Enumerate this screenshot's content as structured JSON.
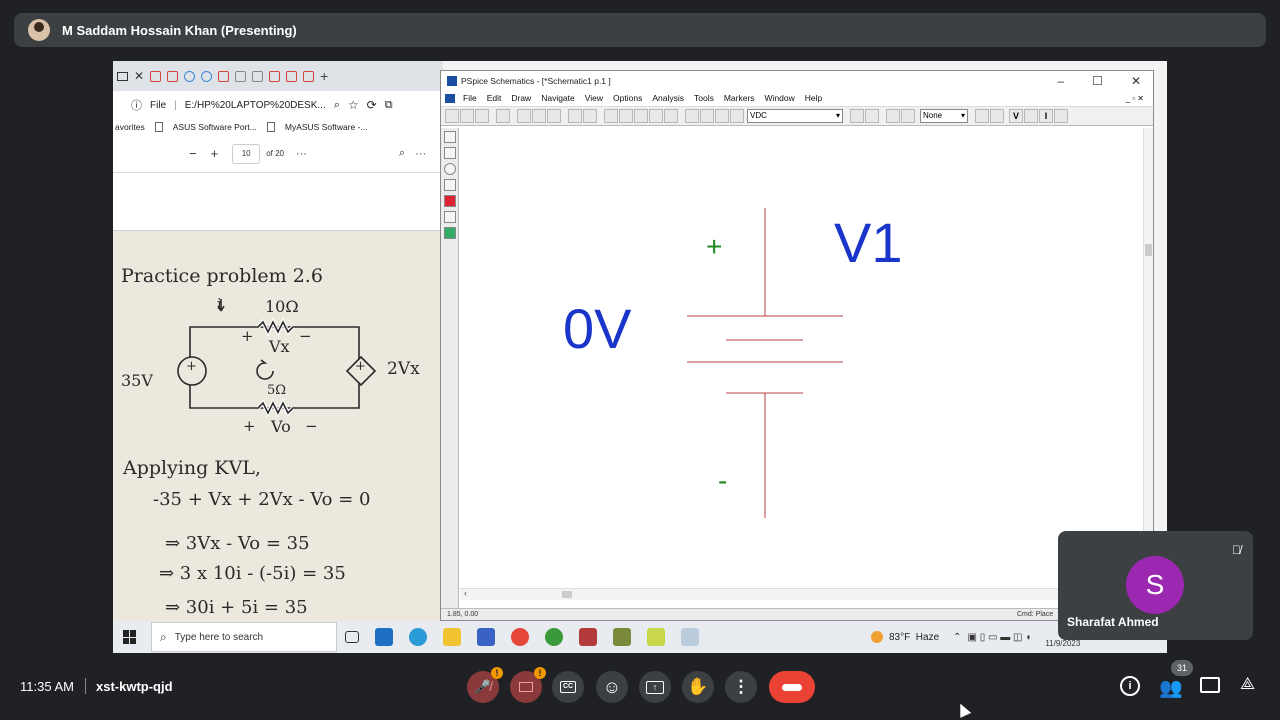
{
  "meet": {
    "presenter_name": "M Saddam Hossain Khan (Presenting)",
    "time": "11:35 AM",
    "meeting_code": "xst-kwtp-qjd",
    "participant_count": "31",
    "tile_initial": "S",
    "tile_name": "Sharafat Ahmed",
    "colors": {
      "tile_avatar": "#9c27b0",
      "end_call": "#ea4335",
      "warning_badge": "#f29900"
    }
  },
  "edge": {
    "tab_count": "8",
    "address_protocol": "File",
    "address": "E:/HP%20LAPTOP%20DESK...",
    "favorites": [
      "avorites",
      "ASUS Software Port...",
      "MyASUS Software -..."
    ],
    "page_current": "10",
    "page_total": "of 20",
    "minus": "−",
    "plus": "+"
  },
  "notes": {
    "title": "Practice problem 2.6",
    "r_top": "10Ω",
    "r_bottom": "5Ω",
    "vx": "Vx",
    "vo": "Vo",
    "source_left": "35V",
    "source_right": "2Vx",
    "plus": "+",
    "minus": "−",
    "current": "i",
    "applying": "Applying KVL,",
    "eq1": "-35 + Vx + 2Vx - Vo = 0",
    "eq2": "⇒ 3Vx - Vo = 35",
    "eq3": "⇒ 3 x 10i - (-5i) = 35",
    "eq4": "⇒ 30i + 5i = 35"
  },
  "pspice": {
    "title": "PSpice Schematics - [*Schematic1  p.1  ]",
    "menu": [
      "File",
      "Edit",
      "Draw",
      "Navigate",
      "View",
      "Options",
      "Analysis",
      "Tools",
      "Markers",
      "Window",
      "Help"
    ],
    "part_select": "VDC",
    "probe_select": "None",
    "v_button": "V",
    "i_button": "I",
    "component_name": "V1",
    "component_value": "0V",
    "plus_sign": "+",
    "minus_sign": "-",
    "coords": "1.85, 0.00",
    "cmd": "Cmd: Place"
  },
  "taskbar": {
    "search_placeholder": "Type here to search",
    "weather": "83°F  Haze",
    "date": "11/9/2023"
  }
}
